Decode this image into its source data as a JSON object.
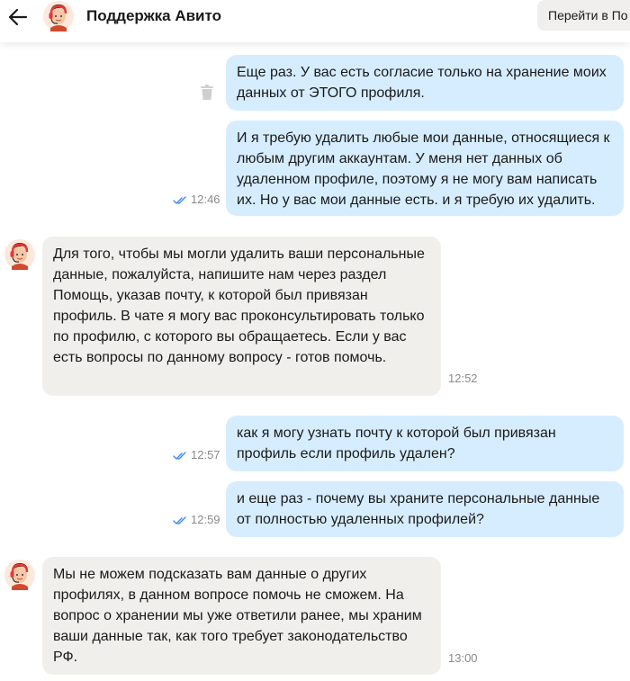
{
  "header": {
    "title": "Поддержка Авито",
    "goto_button": "Перейти в По",
    "back_icon": "arrow-left-icon",
    "avatar_icon": "support-agent-avatar"
  },
  "messages": [
    {
      "id": "m1",
      "direction": "outgoing",
      "text": "Еще раз. У вас есть согласие только на хранение моих данных от ЭТОГО профиля.",
      "time": ""
    },
    {
      "id": "m2",
      "direction": "outgoing",
      "text": "И я требую удалить любые мои данные, относящиеся к любым другим аккаунтам. У меня нет данных об удаленном профиле, поэтому я не могу вам написать их. Но у вас мои данные есть. и я требую их удалить.",
      "time": "12:46",
      "read": true
    },
    {
      "id": "m3",
      "direction": "incoming",
      "text": "Для того, чтобы мы могли удалить ваши персональные данные, пожалуйста, напишите нам через раздел Помощь, указав почту, к которой был привязан профиль. В чате я могу вас проконсультировать только по профилю, с которого вы обращаетесь. Если у вас есть вопросы по данному вопросу - готов помочь.",
      "time": "12:52"
    },
    {
      "id": "m4",
      "direction": "outgoing",
      "text": "как я могу узнать почту к которой был привязан профиль если профиль удален?",
      "time": "12:57",
      "read": true
    },
    {
      "id": "m5",
      "direction": "outgoing",
      "text": "и еще раз - почему вы храните персональные данные от полностью удаленных профилей?",
      "time": "12:59",
      "read": true
    },
    {
      "id": "m6",
      "direction": "incoming",
      "text": "Мы не можем подсказать вам данные о других профилях, в данном вопросе помочь не сможем. На вопрос о хранении мы уже ответили ранее, мы храним ваши данные так, как того требует законодательство РФ.",
      "time": "13:00"
    }
  ],
  "colors": {
    "outgoing_bubble": "#d6edff",
    "incoming_bubble": "#f1efec",
    "read_check": "#3d8cf5"
  }
}
